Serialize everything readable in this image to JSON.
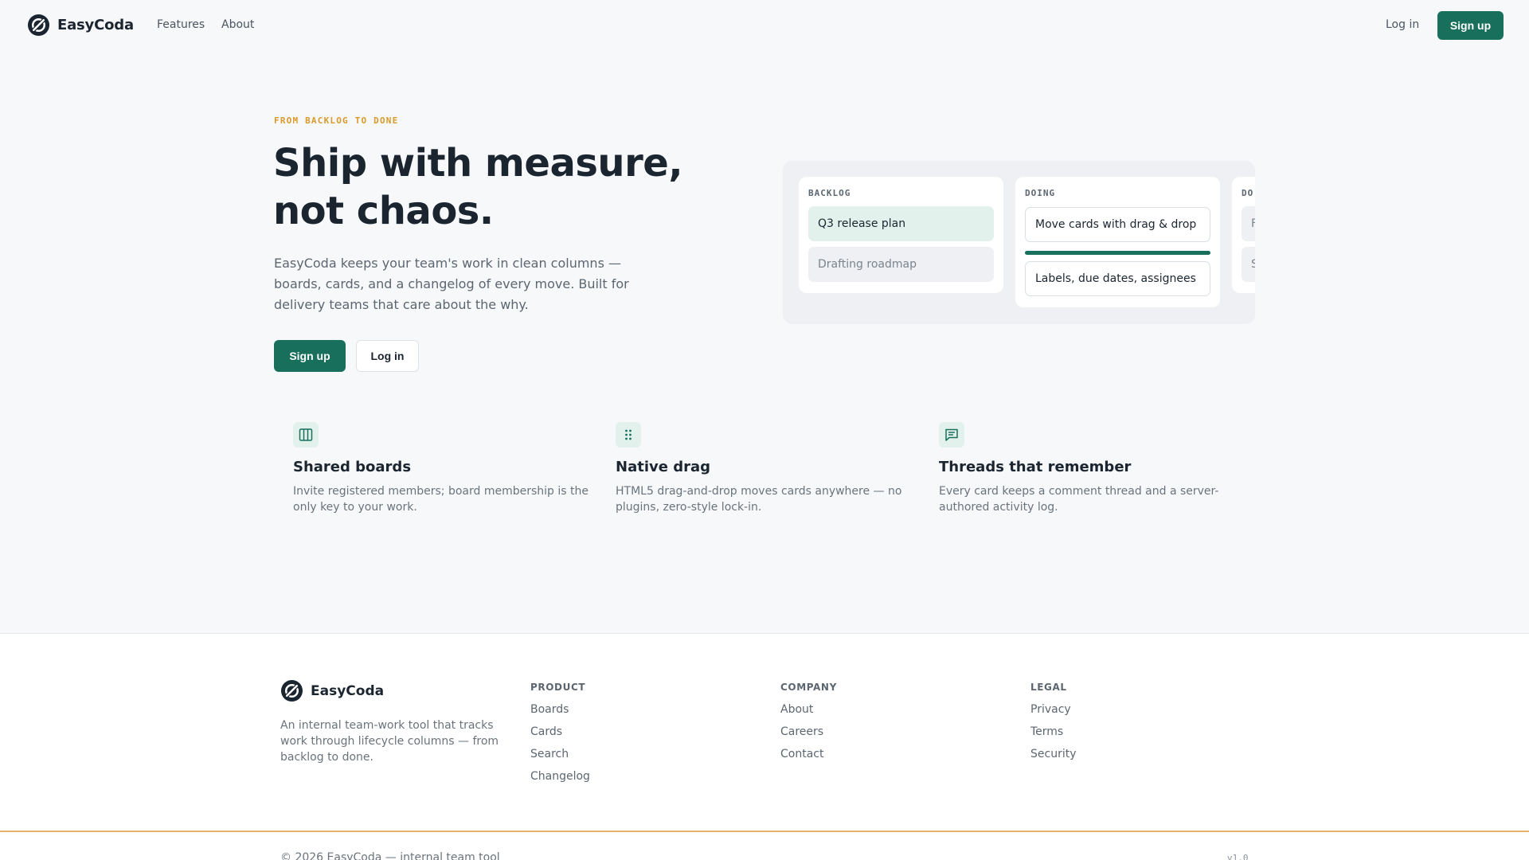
{
  "brand": {
    "name": "EasyCoda",
    "accent": "#176f5c",
    "highlight": "#d99a2b"
  },
  "nav": {
    "features": "Features",
    "about": "About",
    "login": "Log in",
    "signup": "Sign up"
  },
  "hero": {
    "eyebrow": "FROM BACKLOG TO DONE",
    "title": "Ship with measure, not chaos.",
    "subtitle": "EasyCoda keeps your team's work in clean columns — boards, cards, and a changelog of every move. Built for delivery teams that care about the why.",
    "signup": "Sign up",
    "login": "Log in"
  },
  "board": {
    "columns": [
      {
        "title": "BACKLOG",
        "cards": [
          "Q3 release plan",
          "Drafting roadmap"
        ]
      },
      {
        "title": "DOING",
        "cards": [
          "Move cards with drag & drop",
          "Labels, due dates, assignees"
        ]
      },
      {
        "title": "DO",
        "cards": [
          "F",
          "S"
        ]
      }
    ]
  },
  "features": [
    {
      "icon": "columns-icon",
      "title": "Shared boards",
      "desc": "Invite registered members; board membership is the only key to your work."
    },
    {
      "icon": "drag-handle-icon",
      "title": "Native drag",
      "desc": "HTML5 drag-and-drop moves cards anywhere — no plugins, zero-style lock-in."
    },
    {
      "icon": "comment-icon",
      "title": "Threads that remember",
      "desc": "Every card keeps a comment thread and a server-authored activity log."
    }
  ],
  "footer": {
    "brand": "EasyCoda",
    "description": "An internal team-work tool that tracks work through lifecycle columns — from backlog to done.",
    "columns": [
      {
        "title": "PRODUCT",
        "links": [
          "Boards",
          "Cards",
          "Search",
          "Changelog"
        ]
      },
      {
        "title": "COMPANY",
        "links": [
          "About",
          "Careers",
          "Contact"
        ]
      },
      {
        "title": "LEGAL",
        "links": [
          "Privacy",
          "Terms",
          "Security"
        ]
      }
    ],
    "copyright": "© 2026 EasyCoda — internal team tool",
    "version": "v1.0"
  }
}
